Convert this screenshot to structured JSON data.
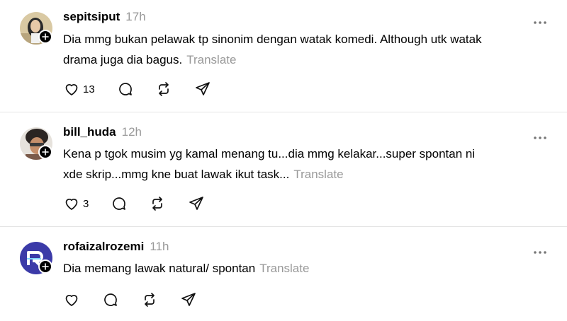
{
  "posts": [
    {
      "username": "sepitsiput",
      "time": "17h",
      "text_line1": "Dia mmg bukan pelawak tp sinonim dengan watak komedi. Although utk watak",
      "text_line2": "drama juga dia bagus.",
      "translate": "Translate",
      "like_count": "13"
    },
    {
      "username": "bill_huda",
      "time": "12h",
      "text_line1": "Kena p tgok musim yg kamal menang tu...dia mmg kelakar...super spontan ni",
      "text_line2": "xde skrip...mmg kne buat lawak ikut task...",
      "translate": "Translate",
      "like_count": "3"
    },
    {
      "username": "rofaizalrozemi",
      "time": "11h",
      "text_line1": "Dia memang lawak natural/ spontan",
      "translate": "Translate",
      "like_count": ""
    }
  ],
  "colors": {
    "muted": "#999999",
    "divider": "#e4e4e4",
    "brand_avatar": "#3b3aa8"
  },
  "icons": [
    "heart-icon",
    "comment-icon",
    "repost-icon",
    "share-icon",
    "more-icon",
    "follow-plus-icon"
  ]
}
